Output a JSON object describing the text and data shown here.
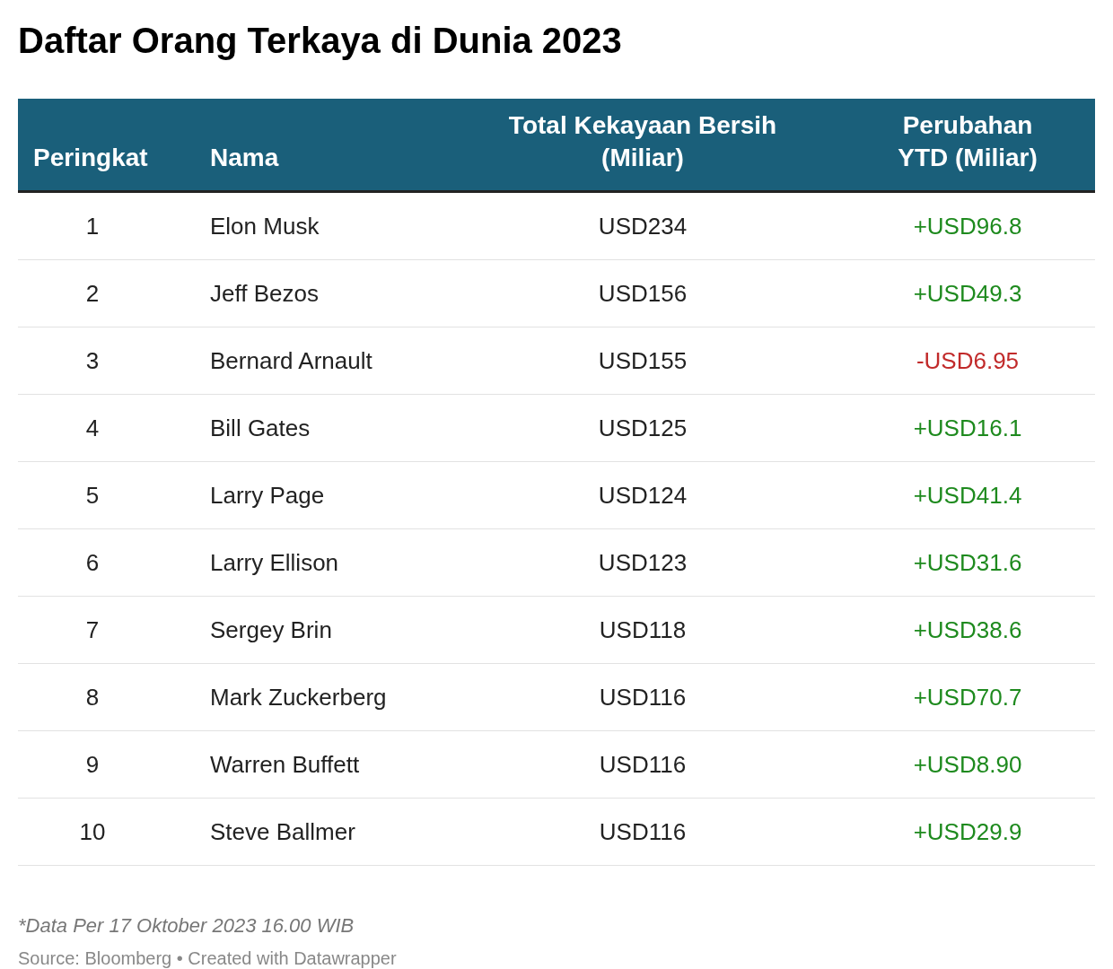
{
  "title": "Daftar Orang Terkaya di Dunia 2023",
  "table": {
    "columns": [
      "Peringkat",
      "Nama",
      "Total Kekayaan Bersih (Miliar)",
      "Perubahan YTD (Miliar)"
    ],
    "rows": [
      {
        "rank": "1",
        "name": "Elon Musk",
        "total": "USD234",
        "change": "+USD96.8",
        "color": "#1e8a1e"
      },
      {
        "rank": "2",
        "name": "Jeff Bezos",
        "total": "USD156",
        "change": "+USD49.3",
        "color": "#1e8a1e"
      },
      {
        "rank": "3",
        "name": "Bernard Arnault",
        "total": "USD155",
        "change": "-USD6.95",
        "color": "#c12a2a"
      },
      {
        "rank": "4",
        "name": "Bill Gates",
        "total": "USD125",
        "change": "+USD16.1",
        "color": "#1e8a1e"
      },
      {
        "rank": "5",
        "name": "Larry Page",
        "total": "USD124",
        "change": "+USD41.4",
        "color": "#1e8a1e"
      },
      {
        "rank": "6",
        "name": "Larry Ellison",
        "total": "USD123",
        "change": "+USD31.6",
        "color": "#1e8a1e"
      },
      {
        "rank": "7",
        "name": "Sergey Brin",
        "total": "USD118",
        "change": "+USD38.6",
        "color": "#1e8a1e"
      },
      {
        "rank": "8",
        "name": "Mark Zuckerberg",
        "total": "USD116",
        "change": "+USD70.7",
        "color": "#1e8a1e"
      },
      {
        "rank": "9",
        "name": "Warren Buffett",
        "total": "USD116",
        "change": "+USD8.90",
        "color": "#1e8a1e"
      },
      {
        "rank": "10",
        "name": "Steve Ballmer",
        "total": "USD116",
        "change": "+USD29.9",
        "color": "#1e8a1e"
      }
    ]
  },
  "notes": "*Data Per 17 Oktober 2023 16.00 WIB",
  "source": "Source: Bloomberg • Created with Datawrapper"
}
